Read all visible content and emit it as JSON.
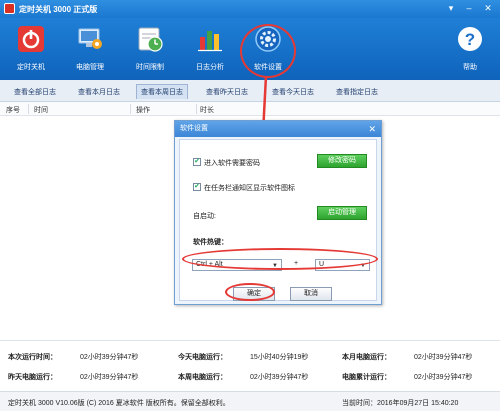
{
  "window": {
    "title": "定时关机 3000 正式版",
    "controls": [
      "menu-icon",
      "minimize-icon",
      "close-icon"
    ]
  },
  "toolbar": {
    "items": [
      {
        "label": "定时关机",
        "icon": "power-icon"
      },
      {
        "label": "电脑管理",
        "icon": "computer-manage-icon"
      },
      {
        "label": "时间限制",
        "icon": "clock-icon"
      },
      {
        "label": "日志分析",
        "icon": "chart-icon"
      },
      {
        "label": "软件设置",
        "icon": "gear-icon"
      },
      {
        "label": "帮助",
        "icon": "help-icon"
      }
    ]
  },
  "tabs": [
    {
      "label": "查看全部日志"
    },
    {
      "label": "查看本月日志"
    },
    {
      "label": "查看本周日志",
      "active": true
    },
    {
      "label": "查看昨天日志"
    },
    {
      "label": "查看今天日志"
    },
    {
      "label": "查看指定日志"
    }
  ],
  "table": {
    "headers": [
      "序号",
      "时间",
      "操作",
      "时长"
    ]
  },
  "dialog": {
    "title": "软件设置",
    "require_password_label": "进入软件需要密码",
    "require_password_checked": true,
    "change_password_button": "修改密码",
    "tray_icon_label": "在任务栏通知区显示软件图标",
    "tray_icon_checked": true,
    "autostart_label": "自启动:",
    "autostart_button": "启动管理",
    "hotkey_label": "软件热键：",
    "hotkey_modifier": "Ctrl + Alt",
    "hotkey_plus": "+",
    "hotkey_key": "U",
    "ok_button": "确定",
    "cancel_button": "取消"
  },
  "stats": {
    "row1": [
      {
        "label": "本次运行时间：",
        "value": "02小时39分钟47秒"
      },
      {
        "label": "今天电脑运行：",
        "value": "15小时40分钟19秒"
      },
      {
        "label": "本月电脑运行：",
        "value": "02小时39分钟47秒"
      }
    ],
    "row2": [
      {
        "label": "昨天电脑运行：",
        "value": "02小时39分钟47秒"
      },
      {
        "label": "本周电脑运行：",
        "value": "02小时39分钟47秒"
      },
      {
        "label": "电脑累计运行：",
        "value": "02小时39分钟47秒"
      }
    ]
  },
  "footer": {
    "copyright": "定时关机 3000 V10.06版 (C) 2016 夏冰软件 版权所有。保留全部权利。",
    "current_time": "当前时间：2016年09月27日 15:40:20"
  },
  "colors": {
    "toolbar": "#1f7fd6",
    "accent_red": "#e53935",
    "green_button": "#2ea32e"
  }
}
